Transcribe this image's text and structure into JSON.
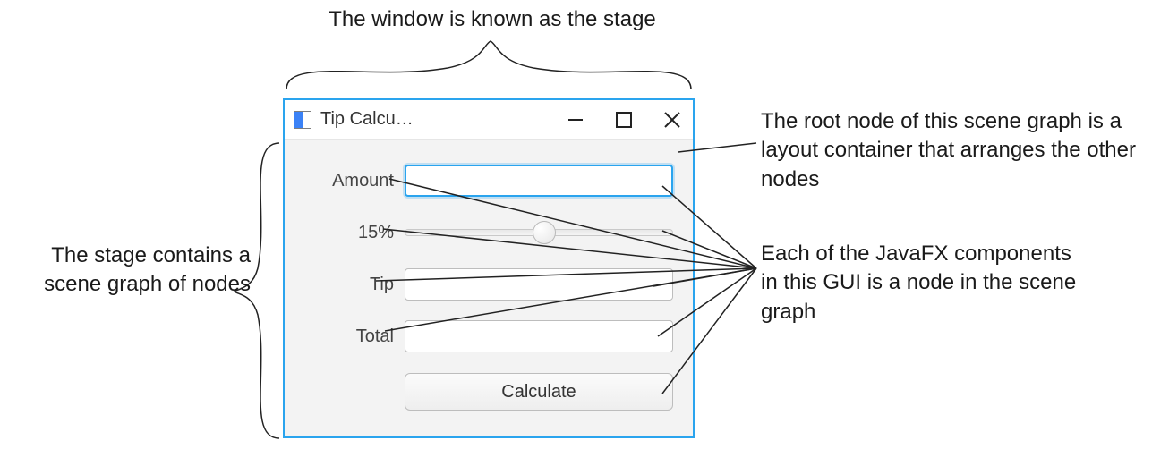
{
  "annotations": {
    "top": "The window is known as the stage",
    "left": "The stage contains a scene graph of nodes",
    "right_top": "The root node of this scene graph is a layout container that arranges the other nodes",
    "right_bottom": "Each of the JavaFX components in this GUI is a node in the scene graph"
  },
  "window": {
    "title": "Tip Calcu…",
    "controls": {
      "minimize": "Minimize",
      "maximize": "Maximize",
      "close": "Close"
    },
    "form": {
      "amount_label": "Amount",
      "amount_value": "",
      "percent_label": "15%",
      "slider_value": 15,
      "tip_label": "Tip",
      "tip_value": "",
      "total_label": "Total",
      "total_value": "",
      "calculate_label": "Calculate"
    }
  },
  "colors": {
    "window_border": "#2aa4ee"
  }
}
